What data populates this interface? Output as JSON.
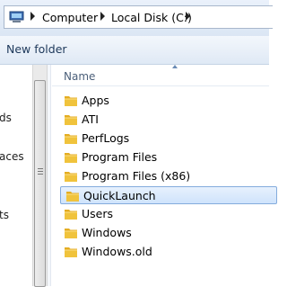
{
  "address": {
    "location_icon": "computer-location-icon",
    "crumbs": [
      "Computer",
      "Local Disk (C:)"
    ]
  },
  "toolbar": {
    "new_folder": "New folder"
  },
  "nav": {
    "fragments": [
      "ds",
      "aces",
      "ts"
    ]
  },
  "list": {
    "column_name": "Name",
    "items": [
      {
        "name": "Apps",
        "selected": false
      },
      {
        "name": "ATI",
        "selected": false
      },
      {
        "name": "PerfLogs",
        "selected": false
      },
      {
        "name": "Program Files",
        "selected": false
      },
      {
        "name": "Program Files (x86)",
        "selected": false
      },
      {
        "name": "QuickLaunch",
        "selected": true
      },
      {
        "name": "Users",
        "selected": false
      },
      {
        "name": "Windows",
        "selected": false
      },
      {
        "name": "Windows.old",
        "selected": false
      }
    ],
    "folder_icon": "folder-icon"
  },
  "colors": {
    "folder": "#f0c33c",
    "selection": "#cfe3fc"
  }
}
